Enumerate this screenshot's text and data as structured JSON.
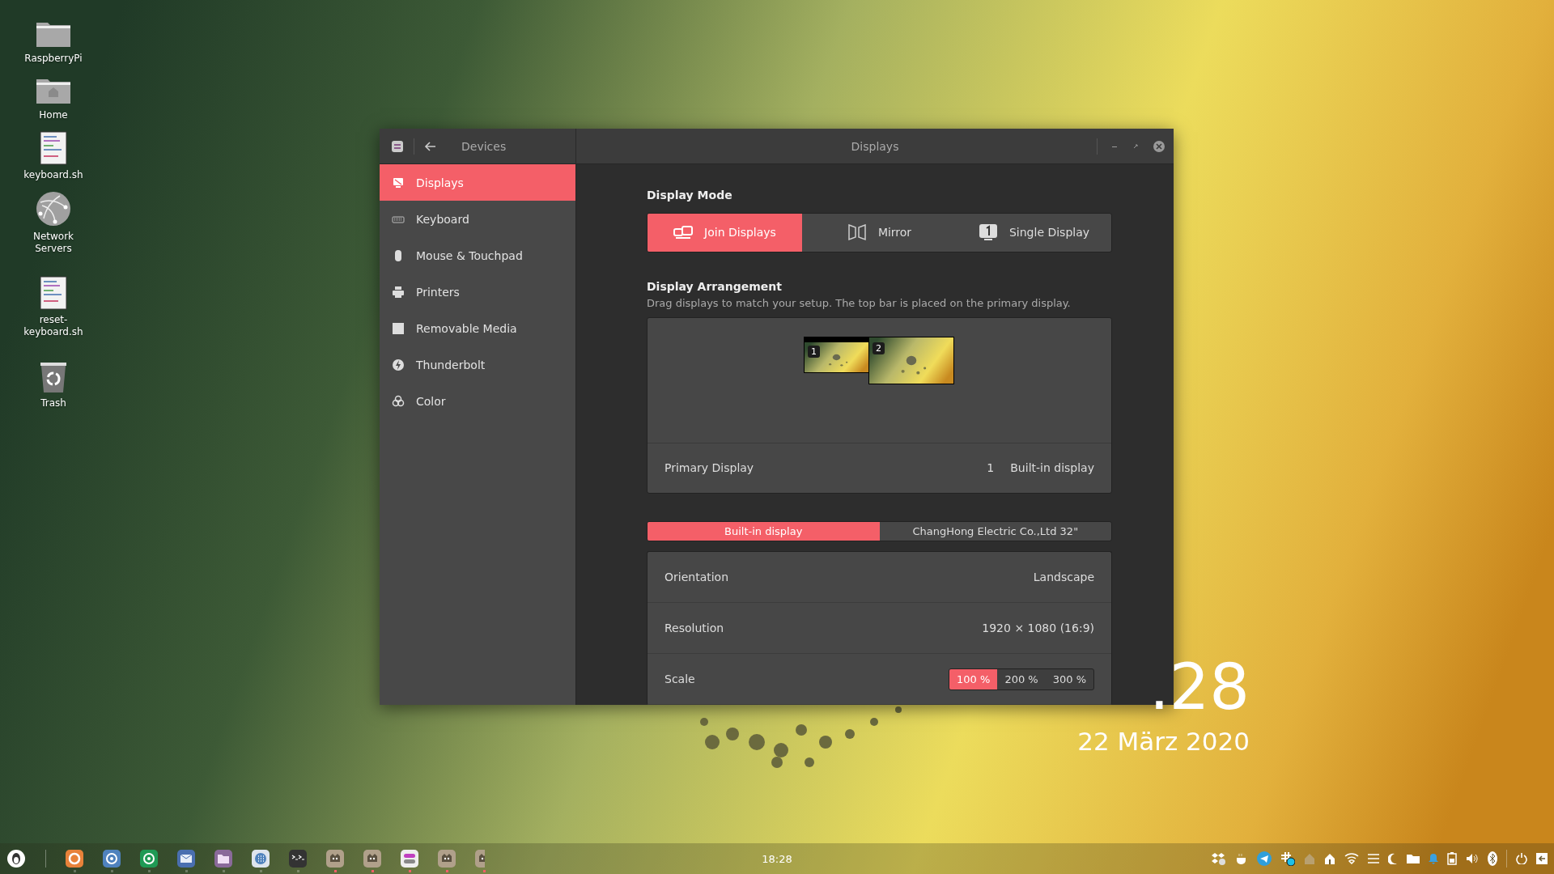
{
  "desktop": {
    "icons": [
      {
        "label": "RaspberryPi",
        "kind": "folder"
      },
      {
        "label": "Home",
        "kind": "home"
      },
      {
        "label": "keyboard.sh",
        "kind": "script"
      },
      {
        "label": "Network Servers",
        "kind": "network"
      },
      {
        "label": "reset-keyboard.sh",
        "kind": "script"
      },
      {
        "label": "Trash",
        "kind": "trash"
      }
    ],
    "clock": {
      "time": ".28",
      "date": "22 März 2020"
    }
  },
  "window": {
    "section": "Devices",
    "title": "Displays"
  },
  "sidebar": {
    "items": [
      {
        "label": "Displays",
        "kind": "display",
        "selected": true
      },
      {
        "label": "Keyboard",
        "kind": "keyboard",
        "selected": false
      },
      {
        "label": "Mouse & Touchpad",
        "kind": "mouse",
        "selected": false
      },
      {
        "label": "Printers",
        "kind": "printer",
        "selected": false
      },
      {
        "label": "Removable Media",
        "kind": "media",
        "selected": false
      },
      {
        "label": "Thunderbolt",
        "kind": "bolt",
        "selected": false
      },
      {
        "label": "Color",
        "kind": "color",
        "selected": false
      }
    ]
  },
  "display_mode": {
    "heading": "Display Mode",
    "options": [
      {
        "label": "Join Displays",
        "kind": "join",
        "selected": true
      },
      {
        "label": "Mirror",
        "kind": "mirror",
        "selected": false
      },
      {
        "label": "Single Display",
        "kind": "single",
        "selected": false
      }
    ]
  },
  "arrangement": {
    "heading": "Display Arrangement",
    "hint": "Drag displays to match your setup. The top bar is placed on the primary display.",
    "monitors": [
      {
        "number": "1",
        "primary": true
      },
      {
        "number": "2",
        "primary": false
      }
    ],
    "primary": {
      "label": "Primary Display",
      "number": "1",
      "name": "Built-in display"
    }
  },
  "monitor_tabs": [
    {
      "label": "Built-in display",
      "selected": true
    },
    {
      "label": "ChangHong Electric Co.,Ltd 32\"",
      "selected": false
    }
  ],
  "settings": [
    {
      "label": "Orientation",
      "kind": "text",
      "value": "Landscape"
    },
    {
      "label": "Resolution",
      "kind": "text",
      "value": "1920 × 1080 (16:9)"
    },
    {
      "label": "Scale",
      "kind": "segmented",
      "options": [
        {
          "label": "100 %",
          "selected": true
        },
        {
          "label": "200 %",
          "selected": false
        },
        {
          "label": "300 %",
          "selected": false
        }
      ]
    }
  ],
  "taskbar": {
    "apps": [
      {
        "kind": "browser-orange",
        "running": false
      },
      {
        "kind": "browser-blue",
        "running": false
      },
      {
        "kind": "browser-green",
        "running": false
      },
      {
        "kind": "mail",
        "running": false
      },
      {
        "kind": "files",
        "running": false
      },
      {
        "kind": "apps",
        "running": false
      },
      {
        "kind": "terminal",
        "running": false
      },
      {
        "kind": "gimp",
        "running": true
      },
      {
        "kind": "gimp",
        "running": true
      },
      {
        "kind": "toggles",
        "running": true
      },
      {
        "kind": "gimp",
        "running": true
      },
      {
        "kind": "gimp-cut",
        "running": true
      }
    ],
    "clock": "18:28"
  }
}
